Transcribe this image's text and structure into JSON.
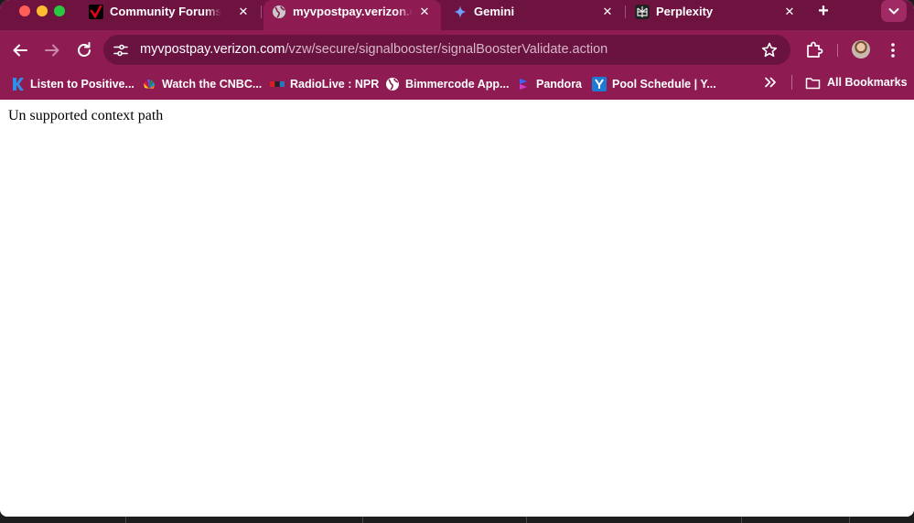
{
  "browser": {
    "tabs": [
      {
        "title": "Community Forums - R",
        "active": false,
        "favicon": "verizon-check-icon"
      },
      {
        "title": "myvpostpay.verizon.co",
        "active": true,
        "favicon": "globe-icon"
      },
      {
        "title": "Gemini",
        "active": false,
        "favicon": "gemini-sparkle-icon"
      },
      {
        "title": "Perplexity",
        "active": false,
        "favicon": "perplexity-icon"
      }
    ],
    "url": {
      "host": "myvpostpay.verizon.com",
      "path": "/vzw/secure/signalbooster/signalBoosterValidate.action"
    },
    "bookmarks": [
      {
        "label": "Listen to Positive...",
        "icon": "k-love-icon"
      },
      {
        "label": "Watch the CNBC...",
        "icon": "nbc-peacock-icon"
      },
      {
        "label": "RadioLive : NPR",
        "icon": "npr-icon"
      },
      {
        "label": "Bimmercode App...",
        "icon": "globe-icon"
      },
      {
        "label": "Pandora",
        "icon": "pandora-icon"
      },
      {
        "label": "Pool Schedule | Y...",
        "icon": "ymca-icon"
      }
    ],
    "all_bookmarks_label": "All Bookmarks",
    "colors": {
      "tab_strip": "#6e1240",
      "toolbar": "#8e1b52",
      "omnibox": "#6a1240"
    }
  },
  "page": {
    "message": "Un supported context path"
  }
}
